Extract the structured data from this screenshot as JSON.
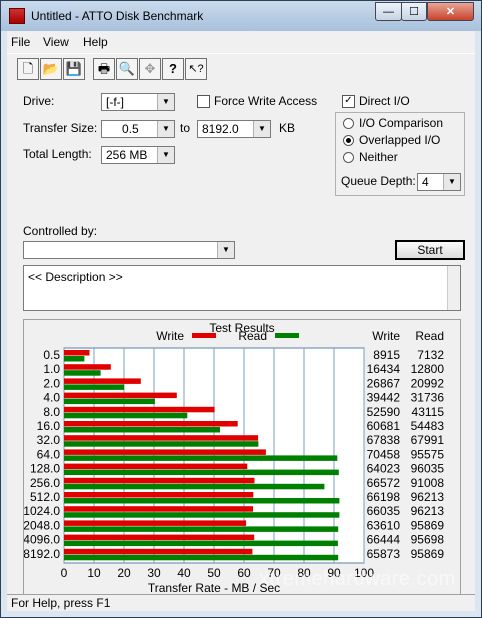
{
  "window": {
    "title": "Untitled - ATTO Disk Benchmark"
  },
  "caption_buttons": {
    "minimize": "—",
    "maximize": "☐",
    "close": "✕"
  },
  "menu": [
    "File",
    "View",
    "Help"
  ],
  "toolbar": [
    {
      "name": "new-file-icon",
      "glyph": "🗋"
    },
    {
      "name": "open-folder-icon",
      "glyph": "📂"
    },
    {
      "name": "save-icon",
      "glyph": "💾"
    },
    {
      "name": "print-icon",
      "glyph": "🖶"
    },
    {
      "name": "print-preview-icon",
      "glyph": "🔍"
    },
    {
      "name": "move-icon",
      "glyph": "✥"
    },
    {
      "name": "help-icon",
      "glyph": "?"
    },
    {
      "name": "context-help-icon",
      "glyph": "↖?"
    }
  ],
  "settings": {
    "drive_label": "Drive:",
    "drive_value": "[-f-]",
    "force_write_label": "Force Write Access",
    "direct_io_label": "Direct I/O",
    "direct_io_checked": "✓",
    "transfer_size_label": "Transfer Size:",
    "transfer_from": "0.5",
    "to_label": "to",
    "transfer_to": "8192.0",
    "kb_label": "KB",
    "total_length_label": "Total Length:",
    "total_length": "256 MB",
    "io_comparison_label": "I/O Comparison",
    "overlapped_io_label": "Overlapped I/O",
    "neither_label": "Neither",
    "queue_depth_label": "Queue Depth:",
    "queue_depth": "4",
    "controlled_by_label": "Controlled by:",
    "controlled_by_value": "",
    "start_label": "Start",
    "description": "<< Description >>"
  },
  "status_bar": "For Help, press F1",
  "watermark": "xtremehardware.com",
  "colors": {
    "write": "#e00000",
    "read": "#008000"
  },
  "chart_data": {
    "type": "bar",
    "orientation": "horizontal",
    "title": "Test Results",
    "xlabel": "Transfer Rate - MB / Sec",
    "xlim": [
      0,
      100
    ],
    "xticks": [
      0,
      10,
      20,
      30,
      40,
      50,
      60,
      70,
      80,
      90,
      100
    ],
    "grid": true,
    "legend": [
      "Write",
      "Read"
    ],
    "column_headers": {
      "write": "Write",
      "read": "Read"
    },
    "categories": [
      "0.5",
      "1.0",
      "2.0",
      "4.0",
      "8.0",
      "16.0",
      "32.0",
      "64.0",
      "128.0",
      "256.0",
      "512.0",
      "1024.0",
      "2048.0",
      "4096.0",
      "8192.0"
    ],
    "series": [
      {
        "name": "Write",
        "values": [
          8.5,
          15.6,
          25.6,
          37.6,
          50.2,
          57.9,
          64.7,
          67.3,
          61.1,
          63.5,
          63.1,
          63.0,
          60.7,
          63.4,
          62.8
        ],
        "labels": [
          "8915",
          "16434",
          "26867",
          "39442",
          "52590",
          "60681",
          "67838",
          "70458",
          "64023",
          "66572",
          "66198",
          "66035",
          "63610",
          "66444",
          "65873"
        ]
      },
      {
        "name": "Read",
        "values": [
          6.8,
          12.2,
          20.0,
          30.3,
          41.1,
          52.0,
          64.8,
          91.1,
          91.6,
          86.8,
          91.8,
          91.8,
          91.4,
          91.3,
          91.4
        ],
        "labels": [
          "7132",
          "12800",
          "20992",
          "31736",
          "43115",
          "54483",
          "67991",
          "95575",
          "96035",
          "91008",
          "96213",
          "96213",
          "95869",
          "95698",
          "95869"
        ]
      }
    ]
  }
}
